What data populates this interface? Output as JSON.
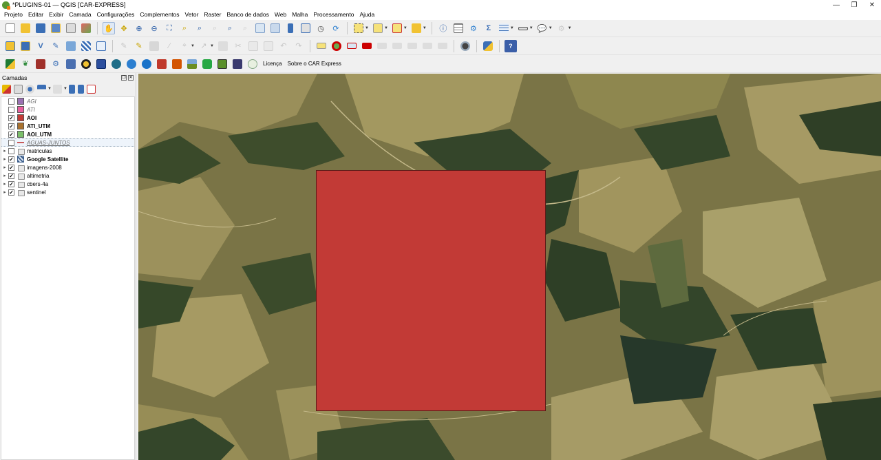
{
  "window": {
    "title": "*PLUGINS-01 — QGIS [CAR-EXPRESS]",
    "controls": [
      "—",
      "❐",
      "✕"
    ]
  },
  "menu": [
    "Projeto",
    "Editar",
    "Exibir",
    "Camada",
    "Configurações",
    "Complementos",
    "Vetor",
    "Raster",
    "Banco de dados",
    "Web",
    "Malha",
    "Processamento",
    "Ajuda"
  ],
  "toolbar3_text": {
    "licenca": "Licença",
    "sobre": "Sobre o CAR Express"
  },
  "layers_panel": {
    "title": "Camadas",
    "float_icon": "❐",
    "close_icon": "✕",
    "layers": [
      {
        "name": "AGI",
        "checked": false,
        "style": "italic",
        "color": "#9b72b3",
        "kind": "polygon"
      },
      {
        "name": "ATI",
        "checked": false,
        "style": "italic",
        "color": "#e85d9e",
        "kind": "polygon"
      },
      {
        "name": "AOI",
        "checked": true,
        "style": "bold",
        "color": "#c23a36",
        "kind": "polygon"
      },
      {
        "name": "ATI_UTM",
        "checked": true,
        "style": "bold",
        "color": "#a9712e",
        "kind": "polygon"
      },
      {
        "name": "AOI_UTM",
        "checked": true,
        "style": "bold",
        "color": "#7bbf6a",
        "kind": "polygon"
      },
      {
        "name": "AGUAS-JUNTOS",
        "checked": false,
        "style": "italic-underline",
        "color": "#c85a5a",
        "kind": "line",
        "selected": true
      },
      {
        "name": "matriculas",
        "checked": false,
        "style": "normal",
        "kind": "group",
        "expandable": true
      },
      {
        "name": "Google Satellite",
        "checked": true,
        "style": "bold",
        "kind": "raster",
        "expandable": true
      },
      {
        "name": "imagens-2008",
        "checked": true,
        "style": "normal",
        "kind": "group",
        "expandable": true
      },
      {
        "name": "altimetria",
        "checked": true,
        "style": "normal",
        "kind": "group",
        "expandable": true
      },
      {
        "name": "cbers-4a",
        "checked": true,
        "style": "normal",
        "kind": "group",
        "expandable": true
      },
      {
        "name": "sentinel",
        "checked": true,
        "style": "normal",
        "kind": "group",
        "expandable": true
      }
    ]
  },
  "colors": {
    "aoi_fill": "#c23a36",
    "map_base": "#6e6a3e"
  }
}
